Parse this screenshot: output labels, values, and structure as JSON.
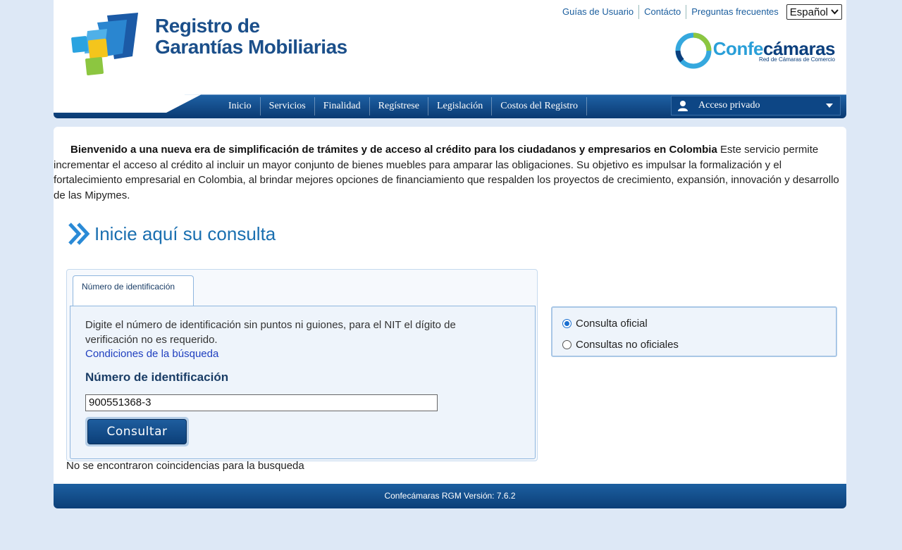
{
  "header": {
    "logo_line1": "Registro de",
    "logo_line2": "Garantías Mobiliarias",
    "top_links": [
      "Guías de Usuario",
      "Contácto",
      "Preguntas frecuentes"
    ],
    "language": "Español",
    "partner_name_light": "Confe",
    "partner_name_bold": "cámaras",
    "partner_tagline": "Red de Cámaras de Comercio",
    "nav": [
      "Inicio",
      "Servicios",
      "Finalidad",
      "Regístrese",
      "Legislación",
      "Costos del Registro"
    ],
    "private_access": "Acceso privado"
  },
  "main": {
    "intro_bold": "Bienvenido a una nueva era de simplificación de trámites y de acceso al crédito para los ciudadanos y empresarios en Colombia",
    "intro_text": " Este servicio permite incrementar el acceso al crédito al incluir un mayor conjunto de bienes muebles para amparar las obligaciones. Su objetivo es impulsar la formalización y el fortalecimiento empresarial en Colombia, al brindar mejores opciones de financiamiento que respalden los proyectos de crecimiento, expansión, innovación y desarrollo de las Mipymes.",
    "section_title": "Inicie aquí su consulta",
    "search": {
      "tab_label": "Número de identificación",
      "instructions": "Digite el número de identificación sin puntos ni guiones, para el NIT el dígito de verificación no es requerido.",
      "conditions_link": "Condiciones de la búsqueda",
      "field_label": "Número de identificación",
      "id_value": "900551368-3",
      "submit_label": "Consultar"
    },
    "no_results": "No se encontraron coincidencias para la busqueda",
    "query_type": {
      "options": [
        "Consulta oficial",
        "Consultas no oficiales"
      ],
      "selected": "Consulta oficial"
    }
  },
  "footer": {
    "version_text": "Confecámaras RGM Versión: 7.6.2"
  },
  "colors": {
    "page_bg": "#dde8f6",
    "nav_blue": "#0c3f78",
    "title_blue": "#1a6fb0",
    "link_blue": "#1f3fbf"
  }
}
